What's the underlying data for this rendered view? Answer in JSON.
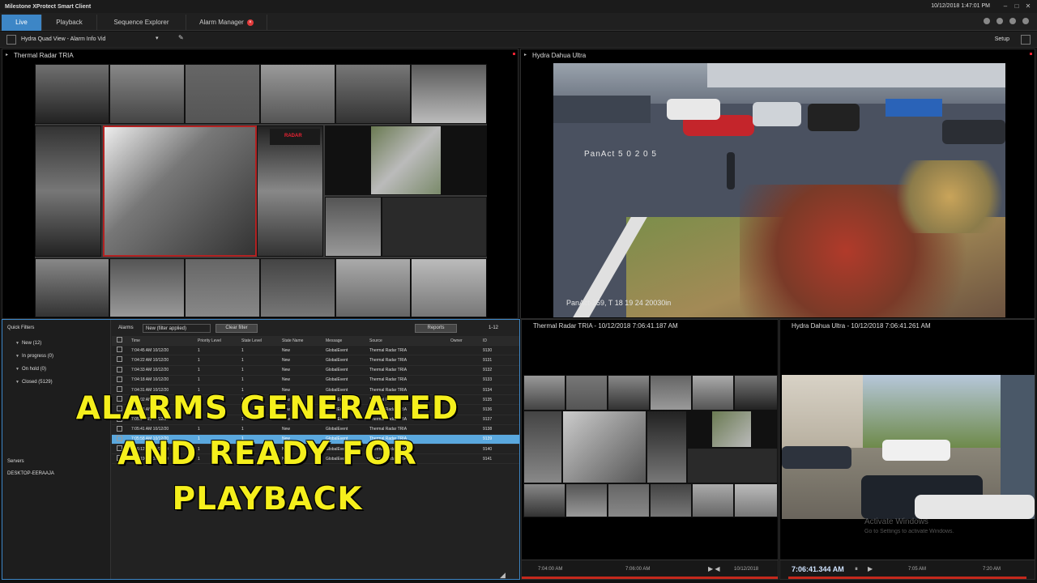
{
  "app": {
    "title": "Milestone XProtect Smart Client",
    "clock": "10/12/2018 1:47:01 PM"
  },
  "tabs": [
    {
      "label": "Live"
    },
    {
      "label": "Playback"
    },
    {
      "label": "Sequence Explorer"
    },
    {
      "label": "Alarm Manager"
    }
  ],
  "viewbar": {
    "view_name": "Hydra Quad View - Alarm Info Vid",
    "setup_label": "Setup"
  },
  "tiles": {
    "thermal_top": "Thermal Radar TRIA",
    "dahua_top": "Hydra Dahua Ultra",
    "thermal_bottom": "Thermal Radar TRIA - 10/12/2018 7:06:41.187 AM",
    "dahua_bottom": "Hydra Dahua Ultra - 10/12/2018 7:06:41.261 AM"
  },
  "camera_overlays": {
    "dahua_top_mid": "PanAct 5 0 2 0 5",
    "dahua_top_bottom": "PanAct-259, T 18 19 24 20030in",
    "radar_logo": "RADAR"
  },
  "alarms": {
    "quick_filters_title": "Quick Filters",
    "quick_filters": [
      "New (12)",
      "In progress (0)",
      "On hold (0)",
      "Closed (5129)"
    ],
    "servers_title": "Servers",
    "server_name": "DESKTOP-EERAAJA",
    "toolbar_label": "Alarms",
    "filter_select": "New (filter applied)",
    "clear_filter": "Clear filter",
    "reports": "Reports",
    "count": "1-12",
    "columns": [
      "Time",
      "Priority Level",
      "State Level",
      "State Name",
      "Message",
      "Source",
      "Owner",
      "ID"
    ],
    "rows": [
      {
        "time": "7:04:45 AM 10/12/20",
        "priority": "1",
        "state_level": "1",
        "state": "New",
        "message": "GlobalEvent",
        "source": "Thermal Radar TRIA",
        "owner": "",
        "id": "9130"
      },
      {
        "time": "7:04:22 AM 10/12/20",
        "priority": "1",
        "state_level": "1",
        "state": "New",
        "message": "GlobalEvent",
        "source": "Thermal Radar TRIA",
        "owner": "",
        "id": "9131"
      },
      {
        "time": "7:04:33 AM 10/12/20",
        "priority": "1",
        "state_level": "1",
        "state": "New",
        "message": "GlobalEvent",
        "source": "Thermal Radar TRIA",
        "owner": "",
        "id": "9132"
      },
      {
        "time": "7:04:18 AM 10/12/20",
        "priority": "1",
        "state_level": "1",
        "state": "New",
        "message": "GlobalEvent",
        "source": "Thermal Radar TRIA",
        "owner": "",
        "id": "9133"
      },
      {
        "time": "7:04:31 AM 10/12/20",
        "priority": "1",
        "state_level": "1",
        "state": "New",
        "message": "GlobalEvent",
        "source": "Thermal Radar TRIA",
        "owner": "",
        "id": "9134"
      },
      {
        "time": "7:05:02 AM 10/12/20",
        "priority": "1",
        "state_level": "1",
        "state": "New",
        "message": "GlobalEvent",
        "source": "Thermal Radar TRIA",
        "owner": "",
        "id": "9135"
      },
      {
        "time": "7:05:14 AM 10/12/20",
        "priority": "1",
        "state_level": "1",
        "state": "New",
        "message": "GlobalEvent",
        "source": "Thermal Radar TRIA",
        "owner": "",
        "id": "9136"
      },
      {
        "time": "7:05:33 AM 10/12/20",
        "priority": "1",
        "state_level": "1",
        "state": "New",
        "message": "GlobalEvent",
        "source": "Thermal Radar TRIA",
        "owner": "",
        "id": "9137"
      },
      {
        "time": "7:05:41 AM 10/12/20",
        "priority": "1",
        "state_level": "1",
        "state": "New",
        "message": "GlobalEvent",
        "source": "Thermal Radar TRIA",
        "owner": "",
        "id": "9138"
      },
      {
        "time": "7:05:58 AM 10/12/20",
        "priority": "1",
        "state_level": "1",
        "state": "New",
        "message": "GlobalEvent",
        "source": "Thermal Radar TRIA",
        "owner": "",
        "id": "9139"
      },
      {
        "time": "7:06:12 AM 10/12/20",
        "priority": "1",
        "state_level": "1",
        "state": "New",
        "message": "GlobalEvent",
        "source": "Thermal Radar TRIA",
        "owner": "",
        "id": "9140"
      },
      {
        "time": "7:06:19 AM 10/12/20",
        "priority": "1",
        "state_level": "1",
        "state": "New",
        "message": "GlobalEvent",
        "source": "Thermal Radar TRIA",
        "owner": "",
        "id": "9141"
      }
    ]
  },
  "overlay_caption": {
    "line1": "ALARMS GENERATED",
    "line2": "AND READY FOR",
    "line3": "PLAYBACK"
  },
  "playback": {
    "left_times": [
      "7:04:00 AM",
      "7:06:00 AM",
      "10/12/2018"
    ],
    "right_bigtime": "7:06:41.344 AM",
    "right_times": [
      "7:05 AM",
      "7:20 AM"
    ]
  },
  "watermark": {
    "line1": "Activate Windows",
    "line2": "Go to Settings to activate Windows."
  },
  "colors": {
    "accent": "#3d86c6",
    "caption": "#f5ef1c",
    "alarm_red": "#c5281c"
  }
}
